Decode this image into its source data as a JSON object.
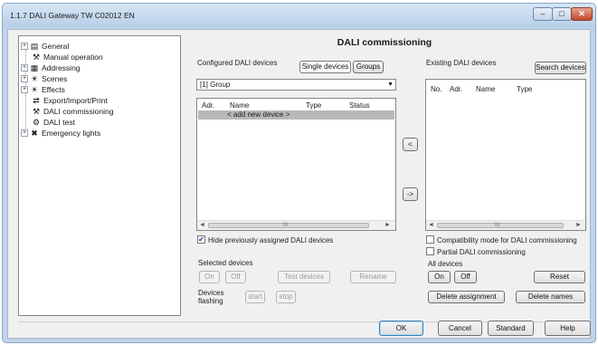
{
  "window": {
    "title": "1.1.7 DALI Gateway TW C02012 EN",
    "minimize": "–",
    "maximize": "□",
    "close": "✕"
  },
  "tree": {
    "items": [
      {
        "label": "General",
        "expander": "+",
        "icon": "▤"
      },
      {
        "label": "Manual operation",
        "expander": "",
        "icon": "⚒"
      },
      {
        "label": "Addressing",
        "expander": "+",
        "icon": "▦"
      },
      {
        "label": "Scenes",
        "expander": "+",
        "icon": "☀"
      },
      {
        "label": "Effects",
        "expander": "+",
        "icon": "☀"
      },
      {
        "label": "Export/Import/Print",
        "expander": "",
        "icon": "⇄"
      },
      {
        "label": "DALI commissioning",
        "expander": "",
        "icon": "⚒"
      },
      {
        "label": "DALI test",
        "expander": "",
        "icon": "⚙"
      },
      {
        "label": "Emergency lights",
        "expander": "+",
        "icon": "✖"
      }
    ]
  },
  "panel": {
    "title": "DALI commissioning",
    "configured_label": "Configured DALI devices",
    "single_devices_tab": "Single devices",
    "groups_tab": "Groups",
    "group_select": "[1] Group",
    "configured_columns": [
      "Adr.",
      "Name",
      "Type",
      "Status"
    ],
    "add_new_device": "< add new device >",
    "move_left": "<",
    "move_right": "->",
    "existing_label": "Existing DALI devices",
    "search_devices": "Search devices",
    "existing_columns": [
      "No.",
      "Adr.",
      "Name",
      "Type"
    ],
    "hide_assigned": "Hide previously assigned DALI devices",
    "compat_mode": "Compatibility mode for DALI commissioning",
    "partial_commissioning": "Partial DALI commissioning",
    "selected_devices_label": "Selected devices",
    "on": "On",
    "off": "Off",
    "test_devices": "Test devices",
    "rename": "Rename",
    "devices_flashing_1": "Devices",
    "devices_flashing_2": "flashing",
    "start": "start",
    "stop": "stop",
    "all_devices_label": "All devices",
    "reset": "Reset",
    "delete_assignment": "Delete assignment",
    "delete_names": "Delete names",
    "scroll_left": "◄",
    "scroll_right": "►",
    "scroll_grip": "III",
    "dropdown_arrow": "▼",
    "check_mark": "✔"
  },
  "footer": {
    "ok": "OK",
    "cancel": "Cancel",
    "standard": "Standard",
    "help": "Help"
  },
  "state": {
    "hide_assigned_checked": true,
    "compat_checked": false,
    "partial_checked": false
  }
}
